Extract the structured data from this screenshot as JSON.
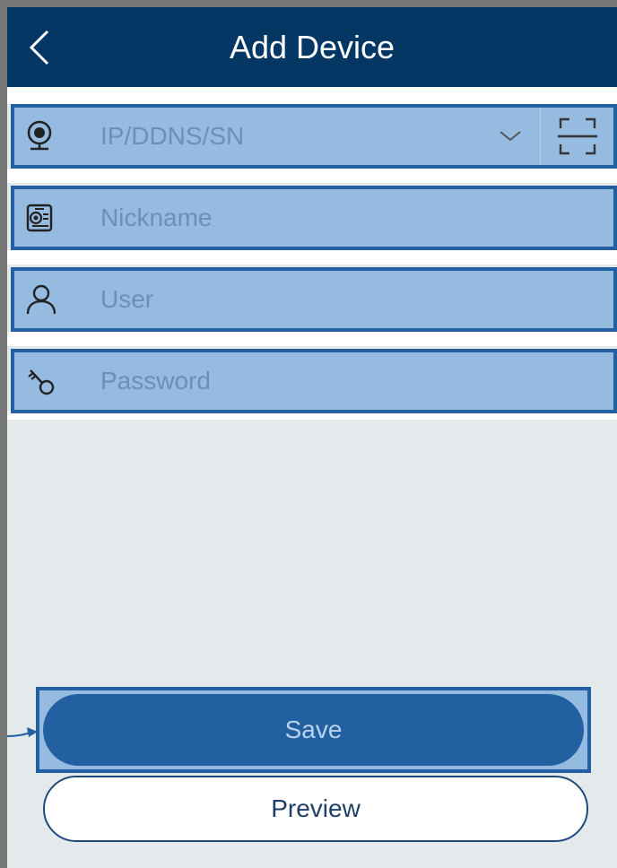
{
  "header": {
    "title": "Add Device"
  },
  "fields": {
    "address": {
      "placeholder": "IP/DDNS/SN"
    },
    "nickname": {
      "placeholder": "Nickname"
    },
    "user": {
      "placeholder": "User"
    },
    "password": {
      "placeholder": "Password"
    }
  },
  "buttons": {
    "save": "Save",
    "preview": "Preview"
  },
  "icons": {
    "back": "chevron-left-icon",
    "address": "webcam-icon",
    "dropdown": "chevron-down-icon",
    "scan": "qr-scan-icon",
    "nickname": "device-card-icon",
    "user": "user-icon",
    "password": "key-icon"
  },
  "colors": {
    "header_bg": "#043763",
    "highlight_fill": "#96bbe0",
    "highlight_border": "#2360a1",
    "background": "#e4eaec"
  }
}
